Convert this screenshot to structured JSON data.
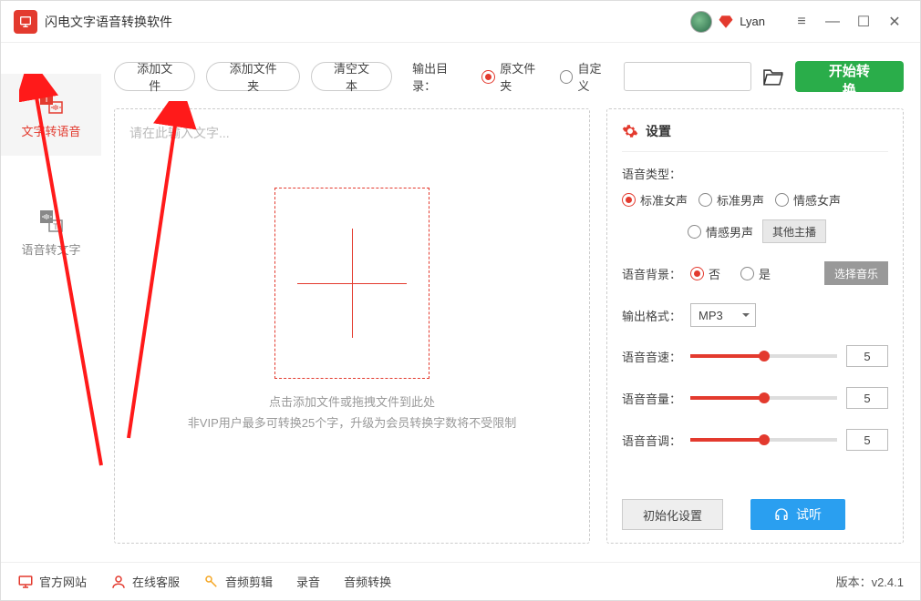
{
  "app": {
    "title": "闪电文字语音转换软件",
    "username": "Lyan"
  },
  "sidebar": {
    "items": [
      {
        "label": "文字转语音"
      },
      {
        "label": "语音转文字"
      }
    ]
  },
  "toolbar": {
    "add_file": "添加文件",
    "add_folder": "添加文件夹",
    "clear_text": "清空文本",
    "output_label": "输出目录：",
    "output_options": [
      "原文件夹",
      "自定义"
    ],
    "start": "开始转换"
  },
  "editor": {
    "placeholder": "请在此输入文字...",
    "drop_hint1": "点击添加文件或拖拽文件到此处",
    "drop_hint2": "非VIP用户最多可转换25个字，升级为会员转换字数将不受限制"
  },
  "settings": {
    "title": "设置",
    "voice_type_label": "语音类型：",
    "voice_types": [
      "标准女声",
      "标准男声",
      "情感女声",
      "情感男声"
    ],
    "other_anchor": "其他主播",
    "bg_label": "语音背景：",
    "bg_options": [
      "否",
      "是"
    ],
    "select_music": "选择音乐",
    "format_label": "输出格式：",
    "format_value": "MP3",
    "speed_label": "语音音速：",
    "speed_value": "5",
    "volume_label": "语音音量：",
    "volume_value": "5",
    "pitch_label": "语音音调：",
    "pitch_value": "5",
    "reset": "初始化设置",
    "listen": "试听"
  },
  "footer": {
    "website": "官方网站",
    "support": "在线客服",
    "audio_edit": "音频剪辑",
    "record": "录音",
    "audio_convert": "音频转换",
    "version_label": "版本：",
    "version": "v2.4.1"
  }
}
